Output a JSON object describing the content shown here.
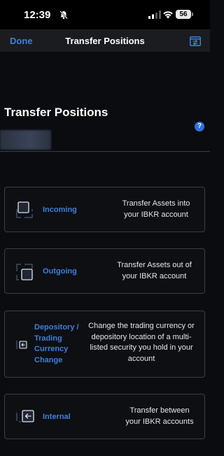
{
  "status_bar": {
    "time": "12:39",
    "battery": "56"
  },
  "nav": {
    "done_label": "Done",
    "title": "Transfer Positions",
    "action_icon": "transfer-icon"
  },
  "page": {
    "heading": "Transfer Positions",
    "help_label": "?"
  },
  "options": [
    {
      "label": "Incoming",
      "description": "Transfer Assets into your IBKR account",
      "icon": "incoming-icon"
    },
    {
      "label": "Outgoing",
      "description": "Transfer Assets out of your IBKR account",
      "icon": "outgoing-icon"
    },
    {
      "label": "Depository / Trading Currency Change",
      "description": "Change the trading currency or depository location of a multi-listed security you hold in your account",
      "icon": "depository-icon"
    },
    {
      "label": "Internal",
      "description": "Transfer between your IBKR accounts",
      "icon": "internal-icon"
    }
  ],
  "colors": {
    "accent": "#3f7fd9",
    "background": "#0b0c10",
    "nav_background": "#1b1c20",
    "card_border": "#3a3d45",
    "help": "#2f6fe0"
  }
}
